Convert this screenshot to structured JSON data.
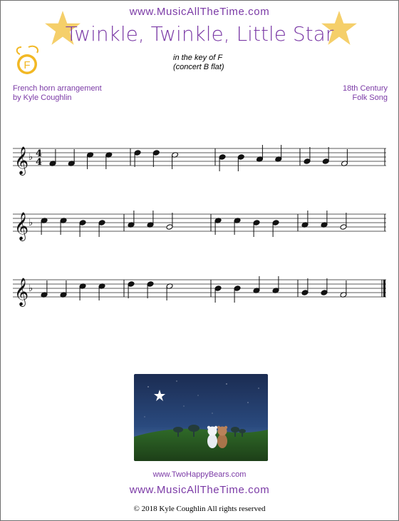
{
  "header": {
    "site_url": "www.MusicAllTheTime.com",
    "title": "Twinkle, Twinkle, Little Star",
    "key_line1": "in the key of F",
    "key_line2": "(concert B flat)",
    "badge_letter": "F"
  },
  "credits": {
    "arrangement_line1": "French horn arrangement",
    "arrangement_line2": "by Kyle Coughlin",
    "origin_line1": "18th Century",
    "origin_line2": "Folk Song"
  },
  "music": {
    "clef": "treble",
    "key_signature": "F major (one flat)",
    "time_signature": "4/4",
    "systems": [
      {
        "measures": [
          [
            "F4-q",
            "F4-q",
            "C5-q",
            "C5-q"
          ],
          [
            "D5-q",
            "D5-q",
            "C5-h"
          ],
          [
            "Bb4-q",
            "Bb4-q",
            "A4-q",
            "A4-q"
          ],
          [
            "G4-q",
            "G4-q",
            "F4-h"
          ]
        ]
      },
      {
        "measures": [
          [
            "C5-q",
            "C5-q",
            "Bb4-q",
            "Bb4-q"
          ],
          [
            "A4-q",
            "A4-q",
            "G4-h"
          ],
          [
            "C5-q",
            "C5-q",
            "Bb4-q",
            "Bb4-q"
          ],
          [
            "A4-q",
            "A4-q",
            "G4-h"
          ]
        ]
      },
      {
        "measures": [
          [
            "F4-q",
            "F4-q",
            "C5-q",
            "C5-q"
          ],
          [
            "D5-q",
            "D5-q",
            "C5-h"
          ],
          [
            "Bb4-q",
            "Bb4-q",
            "A4-q",
            "A4-q"
          ],
          [
            "G4-q",
            "G4-q",
            "F4-h"
          ]
        ]
      }
    ]
  },
  "illustration": {
    "description_icon": "night-sky-bears-illustration"
  },
  "footer": {
    "bears_url": "www.TwoHappyBears.com",
    "site_url": "www.MusicAllTheTime.com",
    "copyright": "© 2018 Kyle Coughlin All rights reserved"
  },
  "colors": {
    "accent": "#7b3aa6",
    "star": "#f5cf6a",
    "badge": "#f2b824"
  }
}
